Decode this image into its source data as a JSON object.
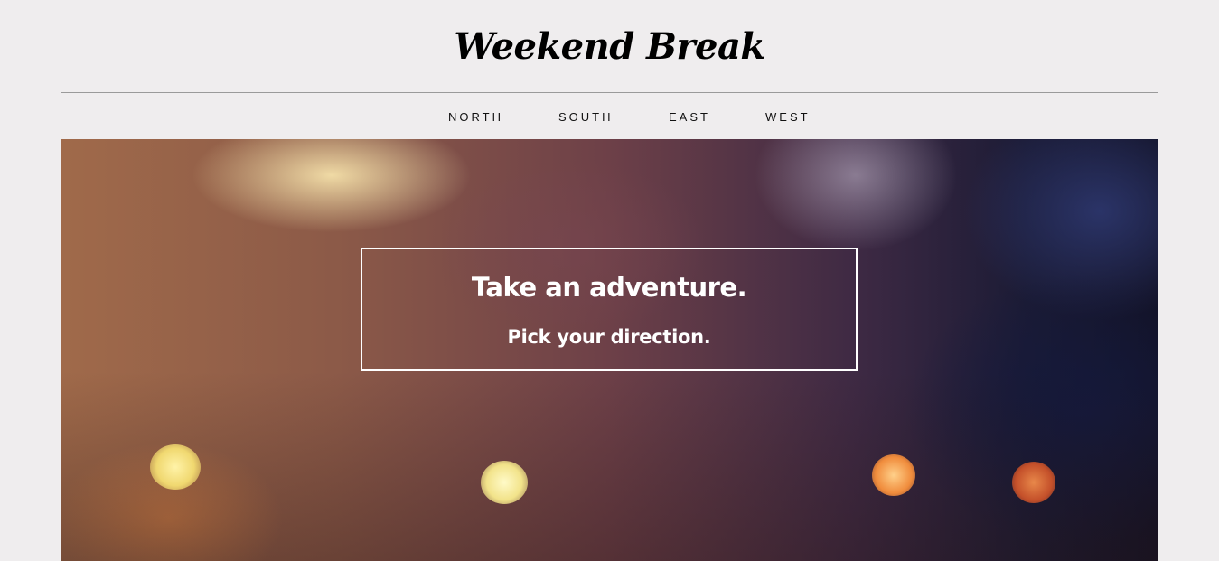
{
  "header": {
    "site_title": "Weekend Break"
  },
  "nav": {
    "items": [
      {
        "label": "NORTH"
      },
      {
        "label": "SOUTH"
      },
      {
        "label": "EAST"
      },
      {
        "label": "WEST"
      }
    ]
  },
  "hero": {
    "headline": "Take an adventure.",
    "subheadline": "Pick your direction."
  }
}
